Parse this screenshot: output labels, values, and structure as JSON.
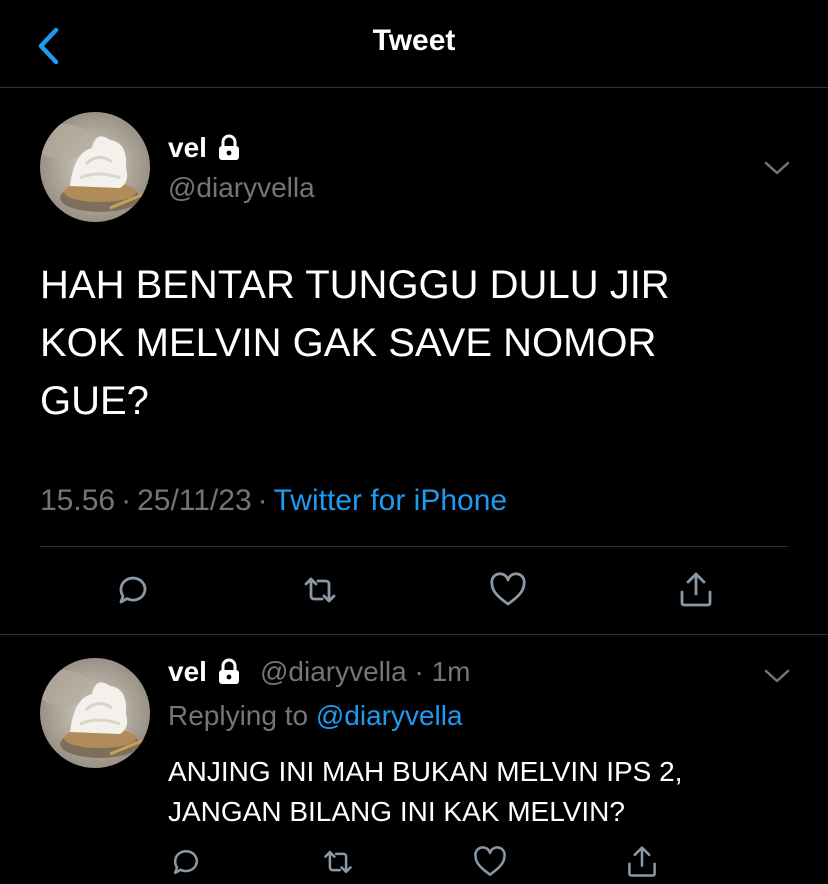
{
  "header": {
    "title": "Tweet",
    "back_icon": "chevron-left-icon"
  },
  "main_tweet": {
    "display_name": "vel",
    "handle": "@diaryvella",
    "text_lines": [
      "HAH BENTAR TUNGGU DULU JIR",
      "KOK MELVIN GAK SAVE NOMOR",
      "GUE?"
    ],
    "time": "15.56",
    "date": "25/11/23",
    "source": "Twitter for iPhone",
    "separator": "·"
  },
  "reply_tweet": {
    "display_name": "vel",
    "handle": "@diaryvella",
    "separator": "·",
    "age": "1m",
    "replying_prefix": "Replying to",
    "replying_to": "@diaryvella",
    "text_lines": [
      "ANJING INI MAH BUKAN MELVIN IPS 2,",
      "JANGAN BILANG INI KAK MELVIN?"
    ]
  },
  "actions": [
    "reply-icon",
    "retweet-icon",
    "like-icon",
    "share-icon"
  ],
  "colors": {
    "background": "#000000",
    "text": "#ffffff",
    "secondary": "#71767b",
    "accent": "#1d9bf0",
    "divider": "#2f3336"
  }
}
